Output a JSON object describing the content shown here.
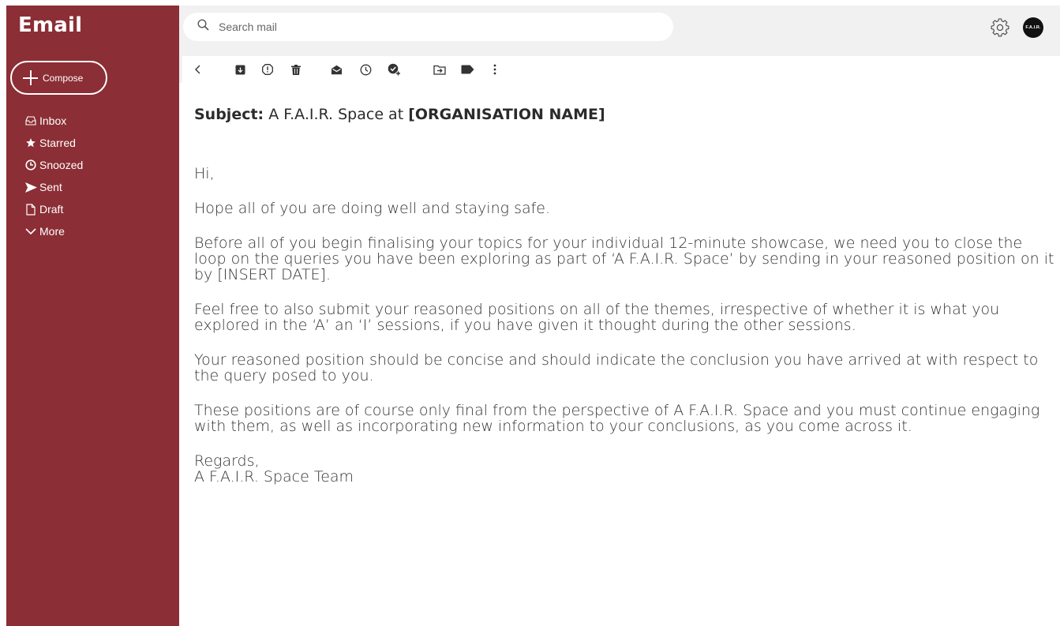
{
  "app": {
    "title": "Email"
  },
  "compose": {
    "label": "Compose"
  },
  "nav": {
    "inbox": "Inbox",
    "starred": "Starred",
    "snoozed": "Snoozed",
    "sent": "Sent",
    "draft": "Draft",
    "more": "More"
  },
  "search": {
    "placeholder": "Search mail"
  },
  "account": {
    "avatar_text": "F.A.I.R."
  },
  "toolbar": {
    "icons": [
      "back-icon",
      "archive-icon",
      "report-spam-icon",
      "delete-icon",
      "mark-unread-icon",
      "snooze-icon",
      "add-task-icon",
      "move-to-icon",
      "label-icon",
      "more-vert-icon"
    ]
  },
  "email": {
    "subject_label": "Subject:",
    "subject_text": "A F.A.I.R. Space at",
    "subject_org": "[ORGANISATION NAME]",
    "greeting": "Hi,",
    "para1": "Hope all of you are doing well and staying safe.",
    "para2": "Before all of you begin finalising your topics for your individual 12-minute showcase, we need you to close the loop on the queries you have been exploring as part of ‘A F.A.I.R. Space’ by sending in your reasoned position on it by [INSERT DATE].",
    "para3": "Feel free to also submit your reasoned positions on all of the themes, irrespective of whether it is what you explored in the ‘A’ an ‘I’ sessions, if you have given it thought during the other sessions.",
    "para4": "Your reasoned position should be concise and should indicate the conclusion you have arrived at with respect to the query posed to you.",
    "para5": "These positions are of course only final from the perspective of A F.A.I.R. Space and you must continue engaging with them, as well as incorporating new information to your conclusions, as you come across it.",
    "closing": "Regards,",
    "signature": "A F.A.I.R. Space Team"
  },
  "colors": {
    "sidebar": "#8b2e35",
    "background": "#f1f1f1",
    "text": "#2b2b2b"
  }
}
